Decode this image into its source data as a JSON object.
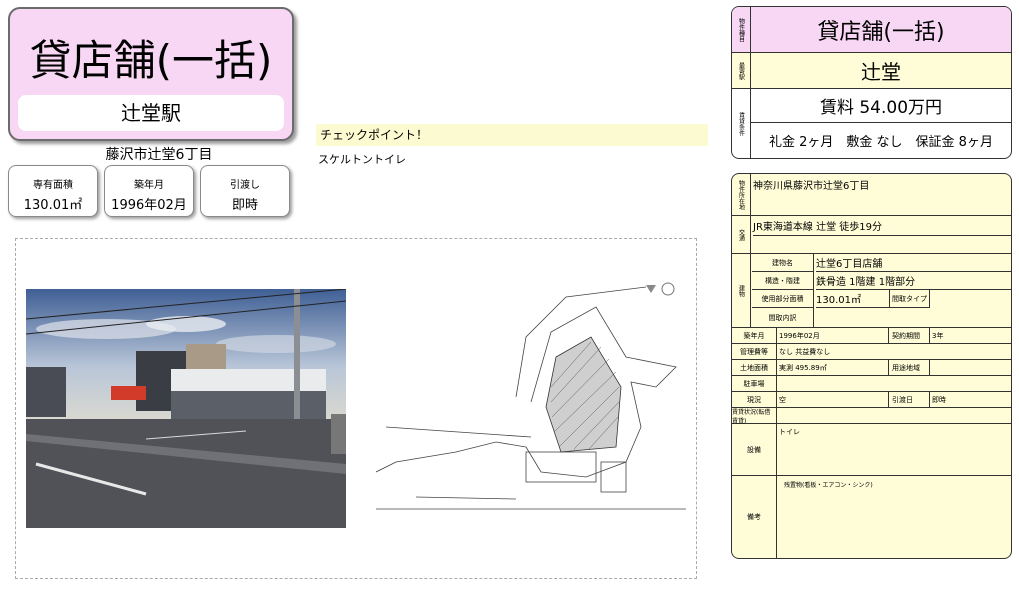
{
  "title": "貸店舗(一括)",
  "station": "辻堂駅",
  "address": "藤沢市辻堂6丁目",
  "stats": [
    {
      "label": "専有面積",
      "value": "130.01㎡"
    },
    {
      "label": "築年月",
      "value": "1996年02月"
    },
    {
      "label": "引渡し",
      "value": "即時"
    }
  ],
  "checkpoint": {
    "heading": "チェックポイント！",
    "text": "スケルトントイレ"
  },
  "panel1": {
    "type_label": "物件種目",
    "type_value": "貸店舗(一括)",
    "station_label": "最寄駅",
    "station_value": "辻堂",
    "rent_label": "賃貸条件",
    "rent_value": "賃料 54.00万円",
    "terms_value": "礼金 2ヶ月　敷金 なし　保証金 8ヶ月"
  },
  "panel2": {
    "location_label": "物件所在地",
    "location_value": "神奈川県藤沢市辻堂6丁目",
    "traffic_label": "交通",
    "traffic_value": "JR東海道本線 辻堂 徒歩19分",
    "building_label": "建物",
    "bname_label": "建物名",
    "bname_value": "辻堂6丁目店舗",
    "structure_label": "構造・階建",
    "structure_value": "鉄骨造 1階建 1階部分",
    "area_label": "使用部分面積",
    "area_value": "130.01㎡",
    "layout_type_label": "間取タイプ",
    "layout_detail_label": "間取内訳",
    "built_label": "築年月",
    "built_value": "1996年02月",
    "contract_label": "契約期間",
    "contract_value": "3年",
    "fee_label": "管理費等",
    "fee_value": "なし 共益費なし",
    "land_label": "土地面積",
    "land_value": "実測 495.89㎡",
    "zone_label": "用途地域",
    "parking_label": "駐車場",
    "status_label": "現況",
    "status_value": "空",
    "handover_label": "引渡日",
    "handover_value": "即時",
    "lease_label": "賃貸状況(転借 賃貸)",
    "equip_label": "設備",
    "equip_value": "トイレ",
    "note_label": "備考",
    "note_value": "残置物(看板・エアコン・シンク)"
  }
}
